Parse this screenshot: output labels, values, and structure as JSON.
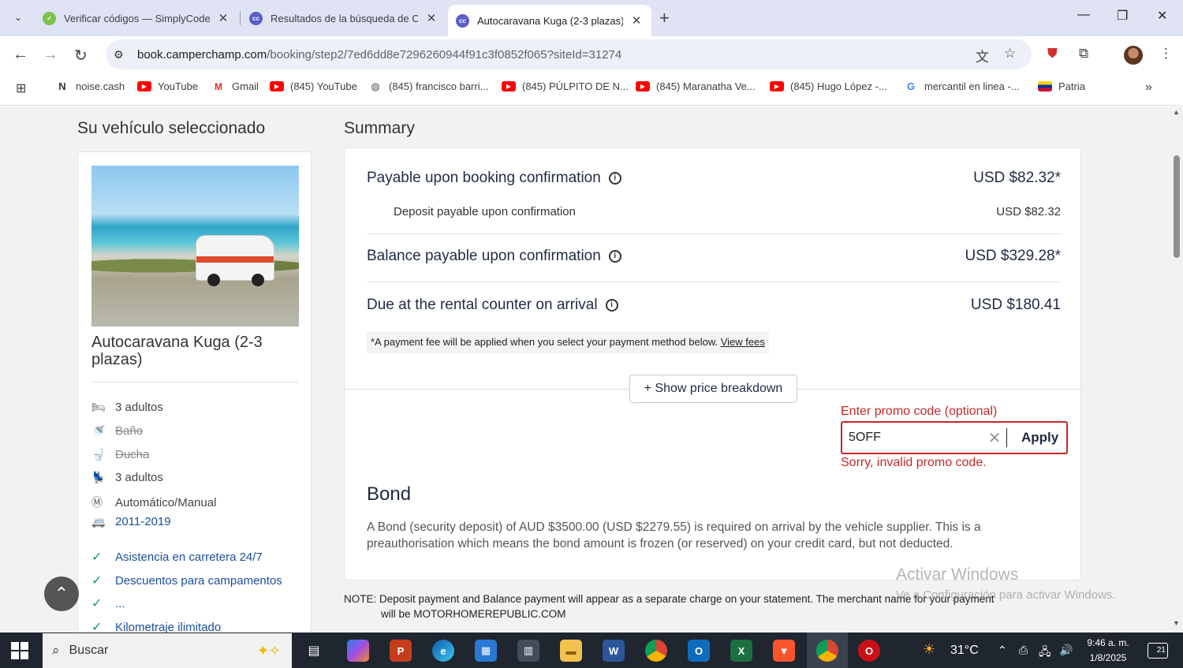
{
  "browser": {
    "tabs": [
      {
        "title": "Verificar códigos — SimplyCode",
        "favicon_color": "#5cb85c",
        "active": false
      },
      {
        "title": "Resultados de la búsqueda de C",
        "favicon_color": "#5b5fc7",
        "active": false
      },
      {
        "title": "Autocaravana Kuga (2-3 plazas)",
        "favicon_color": "#5b5fc7",
        "active": true
      }
    ],
    "favicon_cc": "cc",
    "url_host": "book.camperchamp.com",
    "url_path": "/booking/step2/7ed6dd8e7296260944f91c3f0852f065?siteId=31274",
    "bookmarks": [
      {
        "label": "noise.cash",
        "icon": "noise-icon"
      },
      {
        "label": "YouTube",
        "icon": "youtube-icon"
      },
      {
        "label": "Gmail",
        "icon": "gmail-icon"
      },
      {
        "label": "(845) YouTube",
        "icon": "youtube-icon"
      },
      {
        "label": "(845) francisco barri...",
        "icon": "globe-icon"
      },
      {
        "label": "(845) PÚLPITO DE N...",
        "icon": "youtube-icon"
      },
      {
        "label": "(845) Maranatha Ve...",
        "icon": "youtube-icon"
      },
      {
        "label": "(845) Hugo López -...",
        "icon": "youtube-icon"
      },
      {
        "label": "mercantil en linea -...",
        "icon": "google-icon"
      },
      {
        "label": "Patria",
        "icon": "patria-icon"
      }
    ]
  },
  "vehicle": {
    "section_title": "Su vehículo seleccionado",
    "name": "Autocaravana Kuga (2-3 plazas)",
    "features": [
      {
        "label": "3 adultos",
        "icon": "beds-icon",
        "style": "normal"
      },
      {
        "label": "Baño",
        "icon": "shower-icon",
        "style": "strike"
      },
      {
        "label": "Ducha",
        "icon": "toilet-icon",
        "style": "strike"
      },
      {
        "label": "3 adultos",
        "icon": "seat-icon",
        "style": "normal"
      },
      {
        "label": "Automático/Manual",
        "icon": "transmission-icon",
        "style": "normal"
      },
      {
        "label": "2011-2019",
        "icon": "van-icon",
        "style": "blue"
      }
    ],
    "inclusions": [
      "Asistencia en carretera 24/7",
      "Descuentos para campamentos",
      "...",
      "Kilometraje ilimitado"
    ]
  },
  "summary": {
    "title": "Summary",
    "payable_label": "Payable upon booking confirmation",
    "payable_amount": "USD $82.32*",
    "deposit_label": "Deposit payable upon confirmation",
    "deposit_amount": "USD $82.32",
    "balance_label": "Balance payable upon confirmation",
    "balance_amount": "USD $329.28*",
    "due_label": "Due at the rental counter on arrival",
    "due_amount": "USD $180.41",
    "fee_note": "*A payment fee will be applied when you select your payment method below.",
    "fee_link": "View fees",
    "breakdown_button": "+ Show price breakdown",
    "promo_label": "Enter promo code (optional)",
    "promo_value": "5OFF",
    "promo_apply": "Apply",
    "promo_error": "Sorry, invalid promo code.",
    "bond_title": "Bond",
    "bond_text": "A Bond (security deposit) of AUD $3500.00 (USD $2279.55) is required on arrival by the vehicle supplier. This is a preauthorisation which means the bond amount is frozen (or reserved) on your credit card, but not deducted."
  },
  "note": {
    "label": "NOTE:",
    "line1": "Deposit payment and Balance payment will appear as a separate charge on your statement. The merchant name for your payment",
    "line2": "will be MOTORHOMEREPUBLIC.COM"
  },
  "watermark": {
    "line1": "Activar Windows",
    "line2": "Ve a Configuración para activar Windows."
  },
  "taskbar": {
    "search_placeholder": "Buscar",
    "weather": "31°C",
    "time": "9:46 a. m.",
    "date": "1/8/2025",
    "notifications": "21"
  }
}
